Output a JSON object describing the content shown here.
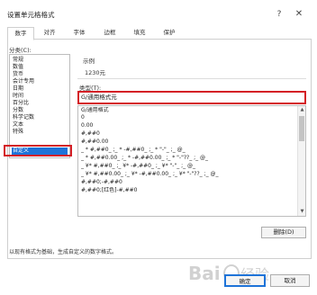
{
  "window": {
    "title": "设置单元格格式",
    "help_label": "?",
    "close_label": "✕"
  },
  "tabs": [
    {
      "label": "数字",
      "active": true
    },
    {
      "label": "对齐",
      "active": false
    },
    {
      "label": "字体",
      "active": false
    },
    {
      "label": "边框",
      "active": false
    },
    {
      "label": "填充",
      "active": false
    },
    {
      "label": "保护",
      "active": false
    }
  ],
  "category": {
    "label": "分类(C):",
    "items": [
      "常规",
      "数值",
      "货币",
      "会计专用",
      "日期",
      "时间",
      "百分比",
      "分数",
      "科学记数",
      "文本",
      "特殊",
      "自定义"
    ],
    "selected": "自定义"
  },
  "sample": {
    "label": "示例",
    "value": "1230元"
  },
  "type": {
    "label": "类型(T):",
    "value": "G/通用格式元"
  },
  "formats": [
    "G/通用格式",
    "0",
    "0.00",
    "#,##0",
    "#,##0.00",
    "_ * #,##0_ ;_ * -#,##0_ ;_ * \"-\"_ ;_ @_",
    "_ * #,##0.00_ ;_ * -#,##0.00_ ;_ * \"-\"??_ ;_ @_",
    "_ ¥* #,##0_ ;_ ¥* -#,##0_ ;_ ¥* \"-\"_ ;_ @_",
    "_ ¥* #,##0.00_ ;_ ¥* -#,##0.00_ ;_ ¥* \"-\"??_ ;_ @_",
    "#,##0;-#,##0",
    "#,##0;[红色]-#,##0"
  ],
  "buttons": {
    "delete": "删除(D)",
    "ok": "确定",
    "cancel": "取消"
  },
  "description": "以现有格式为基础，生成自定义的数字格式。",
  "watermark": "Baidu经验",
  "icons": {
    "help": "help-icon",
    "close": "close-icon",
    "scroll_up": "scroll-up-icon",
    "scroll_down": "scroll-down-icon"
  },
  "colors": {
    "selection": "#1e73d8",
    "highlight": "#d41f26"
  }
}
